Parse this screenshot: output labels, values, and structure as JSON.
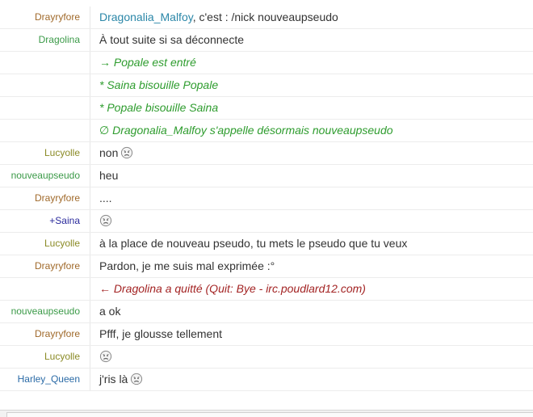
{
  "colors": {
    "nick_orange": "#a0692a",
    "nick_green": "#3b9a48",
    "nick_olive": "#8a8a25",
    "nick_navy": "#2a2a9c",
    "nick_blue": "#2a6aa6",
    "link": "#2b87a8",
    "system_green": "#2e9c2e",
    "quit_red": "#a32424",
    "text": "#333333"
  },
  "messages": [
    {
      "nick": "Drayryfore",
      "nick_color": "#a0692a",
      "mention": "Dragonalia_Malfoy",
      "text": ", c'est : /nick nouveaupseudo"
    },
    {
      "nick": "Dragolina",
      "nick_color": "#3b9a48",
      "text": "À tout suite si sa déconnecte"
    },
    {
      "nick": "",
      "type": "join",
      "arrow": "→",
      "text": "Popale est entré"
    },
    {
      "nick": "",
      "type": "action",
      "text": "* Saina bisouille Popale"
    },
    {
      "nick": "",
      "type": "action",
      "text": "* Popale bisouille Saina"
    },
    {
      "nick": "",
      "type": "nickchange",
      "arrow": "∅",
      "text": "Dragonalia_Malfoy s'appelle désormais nouveaupseudo"
    },
    {
      "nick": "Lucyolle",
      "nick_color": "#8a8a25",
      "text": "non",
      "smiley": "sad-face-icon"
    },
    {
      "nick": "nouveaupseudo",
      "nick_color": "#3b9a48",
      "text": "heu"
    },
    {
      "nick": "Drayryfore",
      "nick_color": "#a0692a",
      "text": "...."
    },
    {
      "nick": "+Saina",
      "nick_color": "#2a2a9c",
      "text": "",
      "smiley": "sad-face-icon"
    },
    {
      "nick": "Lucyolle",
      "nick_color": "#8a8a25",
      "text": "à la place de nouveau pseudo, tu mets le pseudo que tu veux"
    },
    {
      "nick": "Drayryfore",
      "nick_color": "#a0692a",
      "text": "Pardon, je me suis mal exprimée :°"
    },
    {
      "nick": "",
      "type": "quit",
      "arrow": "←",
      "text": "Dragolina a quitté (Quit: Bye - irc.poudlard12.com)"
    },
    {
      "nick": "nouveaupseudo",
      "nick_color": "#3b9a48",
      "text": "a ok"
    },
    {
      "nick": "Drayryfore",
      "nick_color": "#a0692a",
      "text": "Pfff, je glousse tellement"
    },
    {
      "nick": "Lucyolle",
      "nick_color": "#8a8a25",
      "text": "",
      "smiley": "sad-face-icon"
    },
    {
      "nick": "Harley_Queen",
      "nick_color": "#2a6aa6",
      "text": "j'ris là",
      "smiley": "sad-face-icon"
    }
  ]
}
